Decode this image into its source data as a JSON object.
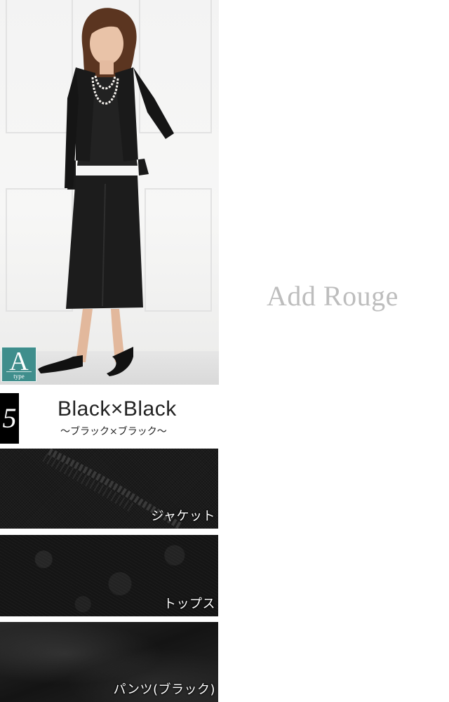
{
  "brand": "Add Rouge",
  "badge": {
    "letter": "A",
    "sub": "type"
  },
  "item_number": "5",
  "color": {
    "title": "Black×Black",
    "subtitle": "～ブラック×ブラック～"
  },
  "swatches": [
    {
      "label": "ジャケット"
    },
    {
      "label": "トップス"
    },
    {
      "label": "パンツ(ブラック)"
    }
  ],
  "colors": {
    "badge": "#3f8e8c",
    "brand": "#bdbdbd",
    "number_tab": "#000000"
  }
}
